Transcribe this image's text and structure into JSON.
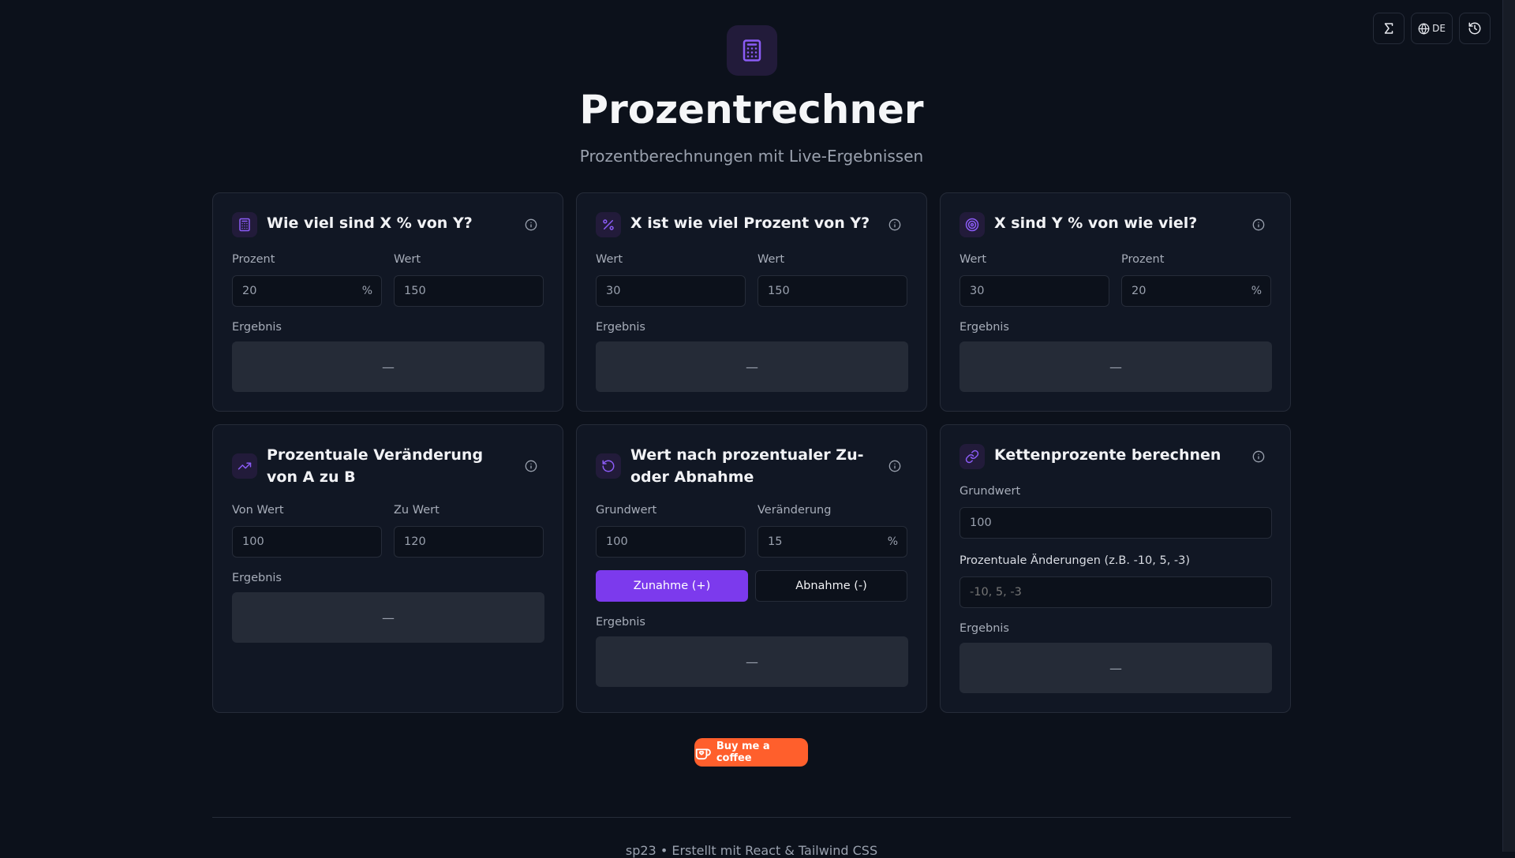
{
  "top_actions": {
    "lang_label": "DE"
  },
  "header": {
    "title": "Prozentrechner",
    "subtitle": "Prozentberechnungen mit Live-Ergebnissen"
  },
  "cards": [
    {
      "title": "Wie viel sind X % von Y?",
      "fields": [
        {
          "label": "Prozent",
          "value": "20",
          "suffix": "%"
        },
        {
          "label": "Wert",
          "value": "150"
        }
      ],
      "result_label": "Ergebnis",
      "result": "—"
    },
    {
      "title": "X ist wie viel Prozent von Y?",
      "fields": [
        {
          "label": "Wert",
          "value": "30"
        },
        {
          "label": "Wert",
          "value": "150"
        }
      ],
      "result_label": "Ergebnis",
      "result": "—"
    },
    {
      "title": "X sind Y % von wie viel?",
      "fields": [
        {
          "label": "Wert",
          "value": "30"
        },
        {
          "label": "Prozent",
          "value": "20",
          "suffix": "%"
        }
      ],
      "result_label": "Ergebnis",
      "result": "—"
    },
    {
      "title": "Prozentuale Veränderung von A zu B",
      "fields": [
        {
          "label": "Von Wert",
          "value": "100"
        },
        {
          "label": "Zu Wert",
          "value": "120"
        }
      ],
      "result_label": "Ergebnis",
      "result": "—"
    },
    {
      "title": "Wert nach prozentualer Zu- oder Abnahme",
      "fields": [
        {
          "label": "Grundwert",
          "value": "100"
        },
        {
          "label": "Veränderung",
          "value": "15",
          "suffix": "%"
        }
      ],
      "increase_label": "Zunahme (+)",
      "decrease_label": "Abnahme (-)",
      "result_label": "Ergebnis",
      "result": "—"
    },
    {
      "title": "Kettenprozente berechnen",
      "base_label": "Grundwert",
      "base_value": "100",
      "changes_label": "Prozentuale Änderungen (z.B. -10, 5, -3)",
      "changes_placeholder": "-10, 5, -3",
      "result_label": "Ergebnis",
      "result": "—"
    }
  ],
  "coffee": {
    "label": "Buy me a coffee"
  },
  "footer": {
    "text": "sp23 • Erstellt mit React & Tailwind CSS"
  },
  "colors": {
    "accent": "#7c3aed",
    "coffee": "#ff5f2c",
    "background": "#0c111b"
  }
}
